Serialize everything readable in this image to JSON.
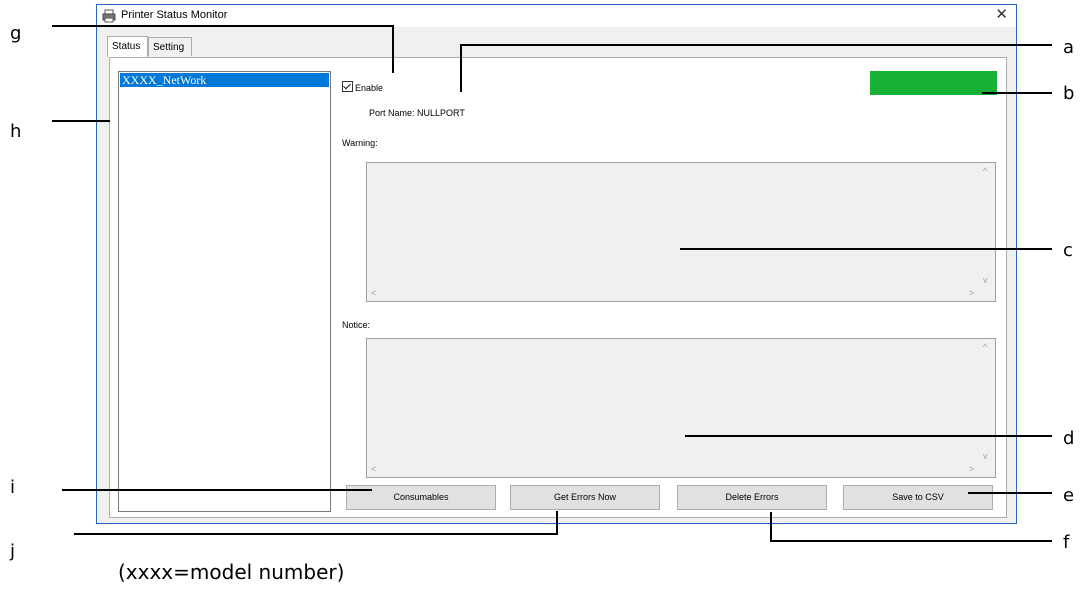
{
  "window": {
    "title": "Printer Status Monitor",
    "close_glyph": "✕",
    "icon": "printer-icon"
  },
  "tabs": [
    {
      "label": "Status",
      "active": true
    },
    {
      "label": "Setting",
      "active": false
    }
  ],
  "printer_list": {
    "items": [
      "XXXX_NetWork"
    ],
    "selected_index": 0
  },
  "status": {
    "enable_label": "Enable",
    "enable_checked": true,
    "port_label": "Port Name: NULLPORT",
    "indicator_color": "#17b137"
  },
  "warning": {
    "label": "Warning:",
    "text": ""
  },
  "notice": {
    "label": "Notice:",
    "text": ""
  },
  "buttons": {
    "consumables": "Consumables",
    "get_errors": "Get Errors Now",
    "delete_errors": "Delete Errors",
    "save_csv": "Save to CSV"
  },
  "callouts": {
    "a": "a",
    "b": "b",
    "c": "c",
    "d": "d",
    "e": "e",
    "f": "f",
    "g": "g",
    "h": "h",
    "i": "i",
    "j": "j"
  },
  "footnote": "(xxxx=model number)",
  "scroll_glyphs": {
    "up": "^",
    "down": "v",
    "left": "<",
    "right": ">"
  }
}
